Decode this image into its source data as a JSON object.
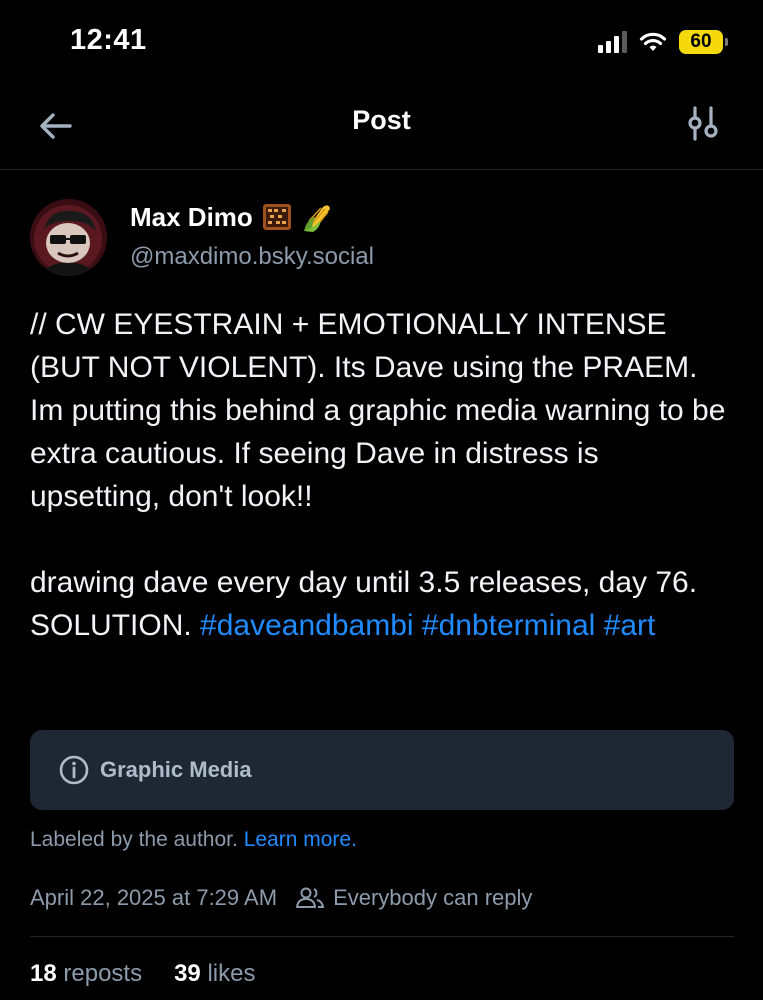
{
  "status_bar": {
    "time": "12:41",
    "battery": "60"
  },
  "header": {
    "title": "Post",
    "back_icon": "arrow-left-icon",
    "settings_icon": "sliders-icon"
  },
  "author": {
    "display_name": "Max Dimo",
    "emojis": [
      "abacus-emoji",
      "corn-emoji"
    ],
    "handle": "@maxdimo.bsky.social"
  },
  "post": {
    "paragraph1": "// CW EYESTRAIN + EMOTIONALLY INTENSE (BUT NOT VIOLENT). Its Dave using the PRAEM. Im putting this behind a graphic media warning to be extra cautious. If seeing Dave in distress is upsetting, don't look!!",
    "paragraph2_text": "drawing dave every day until 3.5 releases, day 76. SOLUTION.",
    "hashtags": [
      "#daveandbambi",
      "#dnbterminal",
      "#art"
    ]
  },
  "media_warning": {
    "label": "Graphic Media",
    "icon": "info-circle-icon"
  },
  "label_note": {
    "text": "Labeled by the author.",
    "link": "Learn more."
  },
  "meta": {
    "timestamp": "April 22, 2025 at 7:29 AM",
    "reply_setting": "Everybody can reply"
  },
  "stats": {
    "reposts_count": "18",
    "reposts_label": "reposts",
    "likes_count": "39",
    "likes_label": "likes"
  },
  "colors": {
    "accent": "#208bfe",
    "muted": "#8c9bab",
    "card_bg": "#1e2733",
    "background": "#000000"
  }
}
